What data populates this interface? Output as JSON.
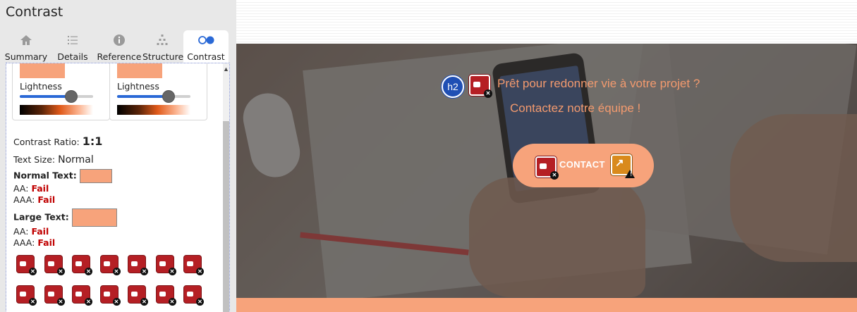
{
  "panel": {
    "title": "Contrast",
    "tabs": [
      {
        "label": "Summary",
        "icon": "home-icon"
      },
      {
        "label": "Details",
        "icon": "list-icon"
      },
      {
        "label": "Reference",
        "icon": "info-icon"
      },
      {
        "label": "Structure",
        "icon": "structure-icon"
      },
      {
        "label": "Contrast",
        "icon": "contrast-icon",
        "active": true
      }
    ],
    "foreground": {
      "lightness_label": "Lightness",
      "color": "#f7a37b",
      "lightness_pct": 65
    },
    "background": {
      "lightness_label": "Lightness",
      "color": "#f7a37b",
      "lightness_pct": 65
    },
    "ratio_label": "Contrast Ratio:",
    "ratio_value": "1:1",
    "text_size_label": "Text Size:",
    "text_size_value": "Normal",
    "normal_text": {
      "label": "Normal Text:",
      "aa_label": "AA:",
      "aa_result": "Fail",
      "aaa_label": "AAA:",
      "aaa_result": "Fail"
    },
    "large_text": {
      "label": "Large Text:",
      "aa_label": "AA:",
      "aa_result": "Fail",
      "aaa_label": "AAA:",
      "aaa_result": "Fail"
    },
    "error_icon_count": 14
  },
  "page": {
    "heading_badge": "h2",
    "hero_line1": "Prêt pour redonner vie à votre projet ?",
    "hero_line2": "Contactez notre équipe !",
    "contact_button": "CONTACT",
    "accent_color": "#f7a37b"
  }
}
